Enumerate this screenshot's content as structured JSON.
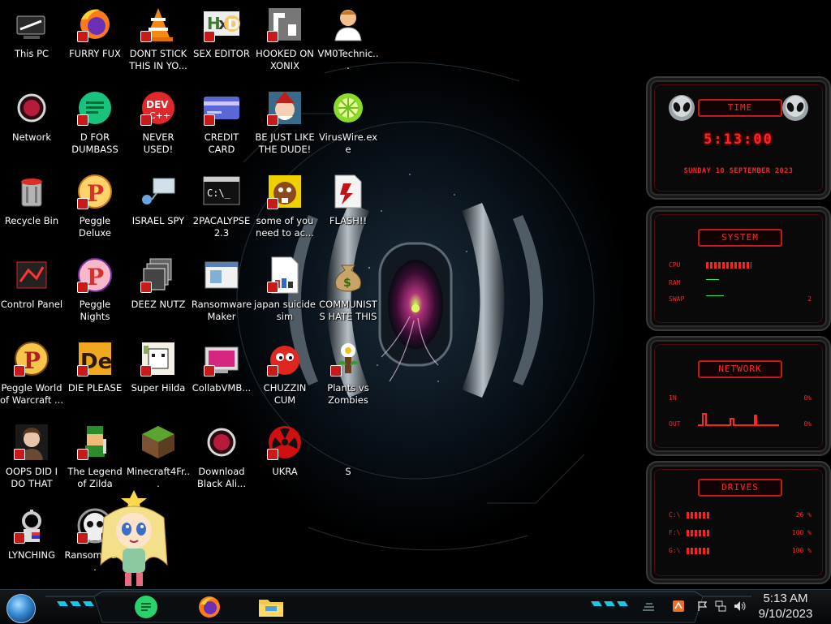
{
  "desktop": {
    "icons": [
      {
        "label": "This PC",
        "icon": "this-pc-icon"
      },
      {
        "label": "FURRY FUX",
        "icon": "firefox-icon"
      },
      {
        "label": "DONT STICK THIS IN YO...",
        "icon": "vlc-cone-icon"
      },
      {
        "label": "SEX EDITOR",
        "icon": "hxd-editor-icon"
      },
      {
        "label": "HOOKED ON XONIX",
        "icon": "xonix-icon"
      },
      {
        "label": "VM0Technic...",
        "icon": "technician-icon"
      },
      {
        "label": "Network",
        "icon": "alien-network-icon"
      },
      {
        "label": "D FOR DUMBASS",
        "icon": "discord-like-icon"
      },
      {
        "label": "NEVER USED!",
        "icon": "dev-cpp-icon"
      },
      {
        "label": "CREDIT CARD CHECKER",
        "icon": "credit-card-icon"
      },
      {
        "label": "BE JUST LIKE THE DUDE!",
        "icon": "elf-icon"
      },
      {
        "label": "VirusWire.exe",
        "icon": "limewire-icon"
      },
      {
        "label": "Recycle Bin",
        "icon": "recycle-bin-icon"
      },
      {
        "label": "Peggle Deluxe",
        "icon": "peggle-icon"
      },
      {
        "label": "ISRAEL SPY",
        "icon": "network-spy-icon"
      },
      {
        "label": "2PACALYPSE 2.3",
        "icon": "terminal-icon"
      },
      {
        "label": "some of you need to ac...",
        "icon": "beaver-icon"
      },
      {
        "label": "FLASH!!",
        "icon": "flash-file-icon"
      },
      {
        "label": "Control Panel",
        "icon": "control-panel-icon"
      },
      {
        "label": "Peggle Nights Deluxe",
        "icon": "peggle-nights-icon"
      },
      {
        "label": "DEEZ NUTZ",
        "icon": "window-stack-icon"
      },
      {
        "label": "Ransomware Maker Build...",
        "icon": "ransomware-builder-icon"
      },
      {
        "label": "japan suicide sim",
        "icon": "document-icon"
      },
      {
        "label": "COMMUNISTS HATE THIS G...",
        "icon": "money-bag-icon"
      },
      {
        "label": "Peggle World of Warcraft ...",
        "icon": "peggle-wow-icon"
      },
      {
        "label": "DIE PLEASE",
        "icon": "die-icon"
      },
      {
        "label": "Super Hilda",
        "icon": "pixel-dog-icon"
      },
      {
        "label": "CollabVMB...",
        "icon": "collabvm-icon"
      },
      {
        "label": "CHUZZIN CUM",
        "icon": "chuzzle-icon"
      },
      {
        "label": "Plants vs Zombies",
        "icon": "plants-vs-zombies-icon"
      },
      {
        "label": "OOPS DID I DO THAT",
        "icon": "portrait-icon"
      },
      {
        "label": "The Legend of Zilda",
        "icon": "zelda-pixel-icon"
      },
      {
        "label": "Minecraft4Fr...",
        "icon": "minecraft-block-icon"
      },
      {
        "label": "Download Black Ali...",
        "icon": "alien-download-icon"
      },
      {
        "label": "UKRA",
        "icon": "radiation-icon"
      },
      {
        "label": "S",
        "icon": "unknown-icon"
      },
      {
        "label": "LYNCHING",
        "icon": "lynching-icon"
      },
      {
        "label": "RansomWar...",
        "icon": "skull-icon"
      }
    ]
  },
  "widgets": {
    "time": {
      "title": "TIME",
      "clock": "5:13:00",
      "date": "SUNDAY 10 SEPTEMBER 2023"
    },
    "system": {
      "title": "SYSTEM",
      "cpu_label": "CPU",
      "ram_label": "RAM",
      "swap_label": "SWAP",
      "swap_value": "2"
    },
    "network": {
      "title": "NETWORK",
      "in_label": "IN",
      "in_value": "0%",
      "out_label": "OUT",
      "out_value": "0%"
    },
    "drives": {
      "title": "DRIVES",
      "rows": [
        {
          "label": "C:\\",
          "value": "26 %",
          "fill": 0.26
        },
        {
          "label": "F:\\",
          "value": "100 %",
          "fill": 1.0
        },
        {
          "label": "G:\\",
          "value": "100 %",
          "fill": 1.0
        }
      ]
    }
  },
  "taskbar": {
    "apps": [
      "notes-app-icon",
      "firefox-icon",
      "file-explorer-icon"
    ],
    "clock_time": "5:13 AM",
    "clock_date": "9/10/2023"
  },
  "colors": {
    "accent_red": "#ff2424",
    "accent_cyan": "#17c7e6"
  }
}
